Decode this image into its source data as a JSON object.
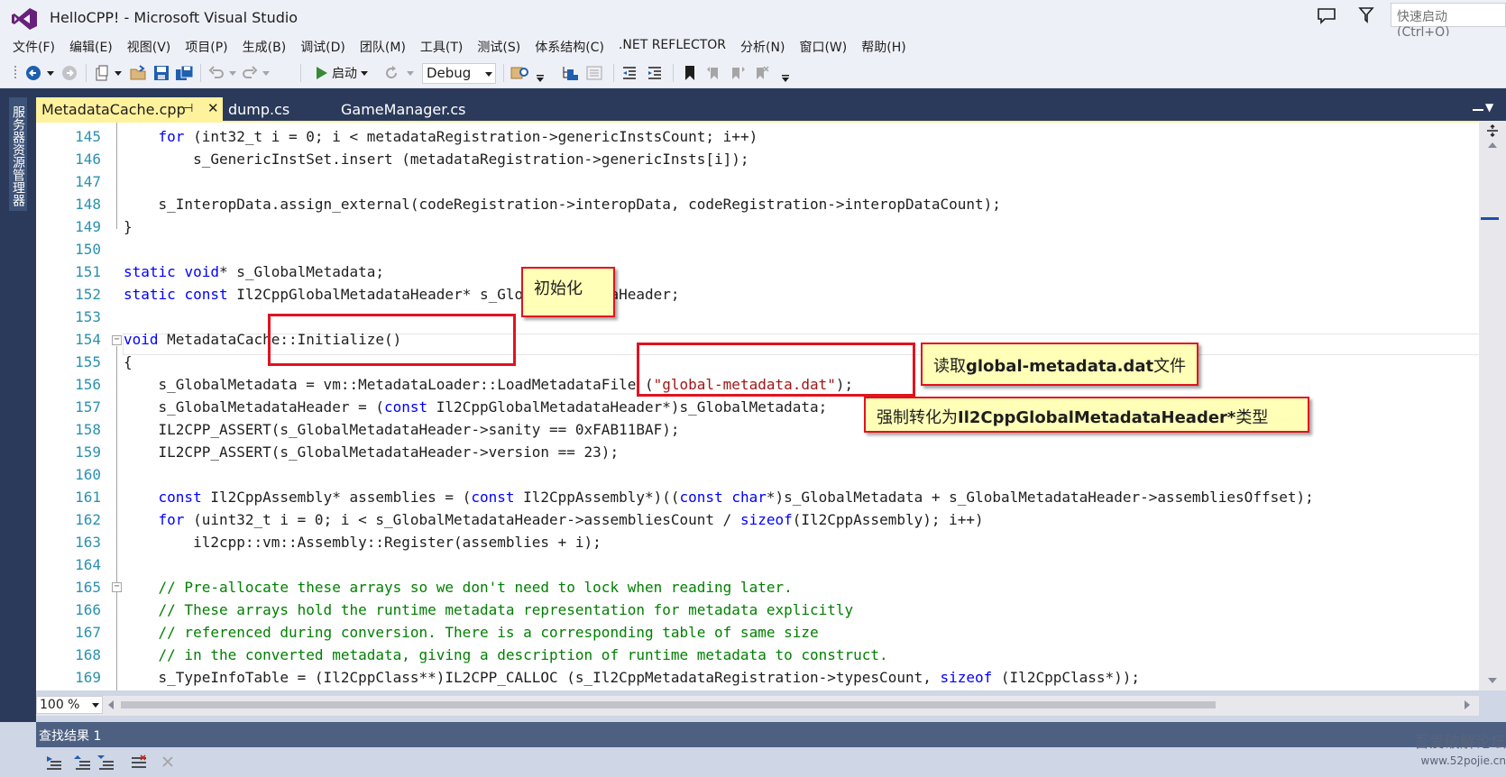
{
  "window": {
    "title": "HelloCPP! - Microsoft Visual Studio",
    "quick_launch_placeholder": "快速启动 (Ctrl+Q)"
  },
  "menu": [
    "文件(F)",
    "编辑(E)",
    "视图(V)",
    "项目(P)",
    "生成(B)",
    "调试(D)",
    "团队(M)",
    "工具(T)",
    "测试(S)",
    "体系结构(C)",
    ".NET REFLECTOR",
    "分析(N)",
    "窗口(W)",
    "帮助(H)"
  ],
  "toolbar": {
    "start_label": "启动",
    "configuration": "Debug"
  },
  "side_panel": {
    "label": "服务器资源管理器"
  },
  "tabs": [
    {
      "label": "MetadataCache.cpp",
      "active": true
    },
    {
      "label": "dump.cs",
      "active": false
    },
    {
      "label": "GameManager.cs",
      "active": false
    }
  ],
  "editor": {
    "line_numbers": [
      "145",
      "146",
      "147",
      "148",
      "149",
      "150",
      "151",
      "152",
      "153",
      "154",
      "155",
      "156",
      "157",
      "158",
      "159",
      "160",
      "161",
      "162",
      "163",
      "164",
      "165",
      "166",
      "167",
      "168",
      "169"
    ],
    "zoom": "100 %"
  },
  "find_results": {
    "title": "查找结果 1"
  },
  "annotations": {
    "init": "初始化",
    "read_file_prefix": "读取",
    "read_file_bold": "global-metadata.dat",
    "read_file_suffix": "文件",
    "cast_prefix": "强制转化为",
    "cast_bold": "Il2CppGlobalMetadataHeader*",
    "cast_suffix": "类型"
  },
  "watermark": {
    "name": "吾爱破解论坛",
    "url": "www.52pojie.cn"
  },
  "colors": {
    "tab_active": "#fff29d",
    "keyword": "#0000ff",
    "string": "#a31515",
    "comment": "#008000",
    "line_number": "#2b91af",
    "annotation_border": "#e0131f",
    "annotation_fill": "#ffffb8"
  }
}
